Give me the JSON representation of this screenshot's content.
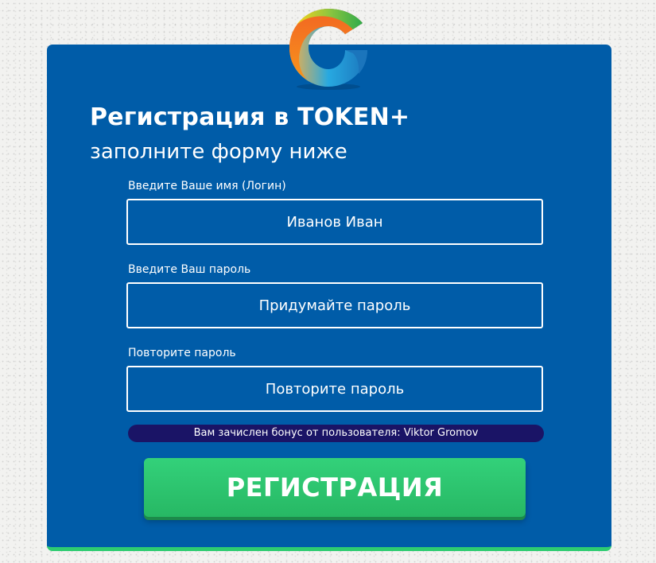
{
  "logo": {
    "icon": "colorful-swirl-g-logo"
  },
  "header": {
    "title": "Регистрация в TOKEN+",
    "subtitle": "заполните форму ниже"
  },
  "form": {
    "login": {
      "label": "Введите Ваше имя (Логин)",
      "value": "Иванов Иван",
      "placeholder": ""
    },
    "password": {
      "label": "Введите Ваш пароль",
      "value": "",
      "placeholder": "Придумайте пароль"
    },
    "password_repeat": {
      "label": "Повторите пароль",
      "value": "",
      "placeholder": "Повторите пароль"
    },
    "bonus_text": "Вам зачислен бонус от пользователя: Viktor Gromov",
    "submit_label": "РЕГИСТРАЦИЯ"
  },
  "colors": {
    "card_background": "#005ca8",
    "button_green": "#2ecc71",
    "bonus_background": "#1a1466",
    "text": "#ffffff"
  }
}
